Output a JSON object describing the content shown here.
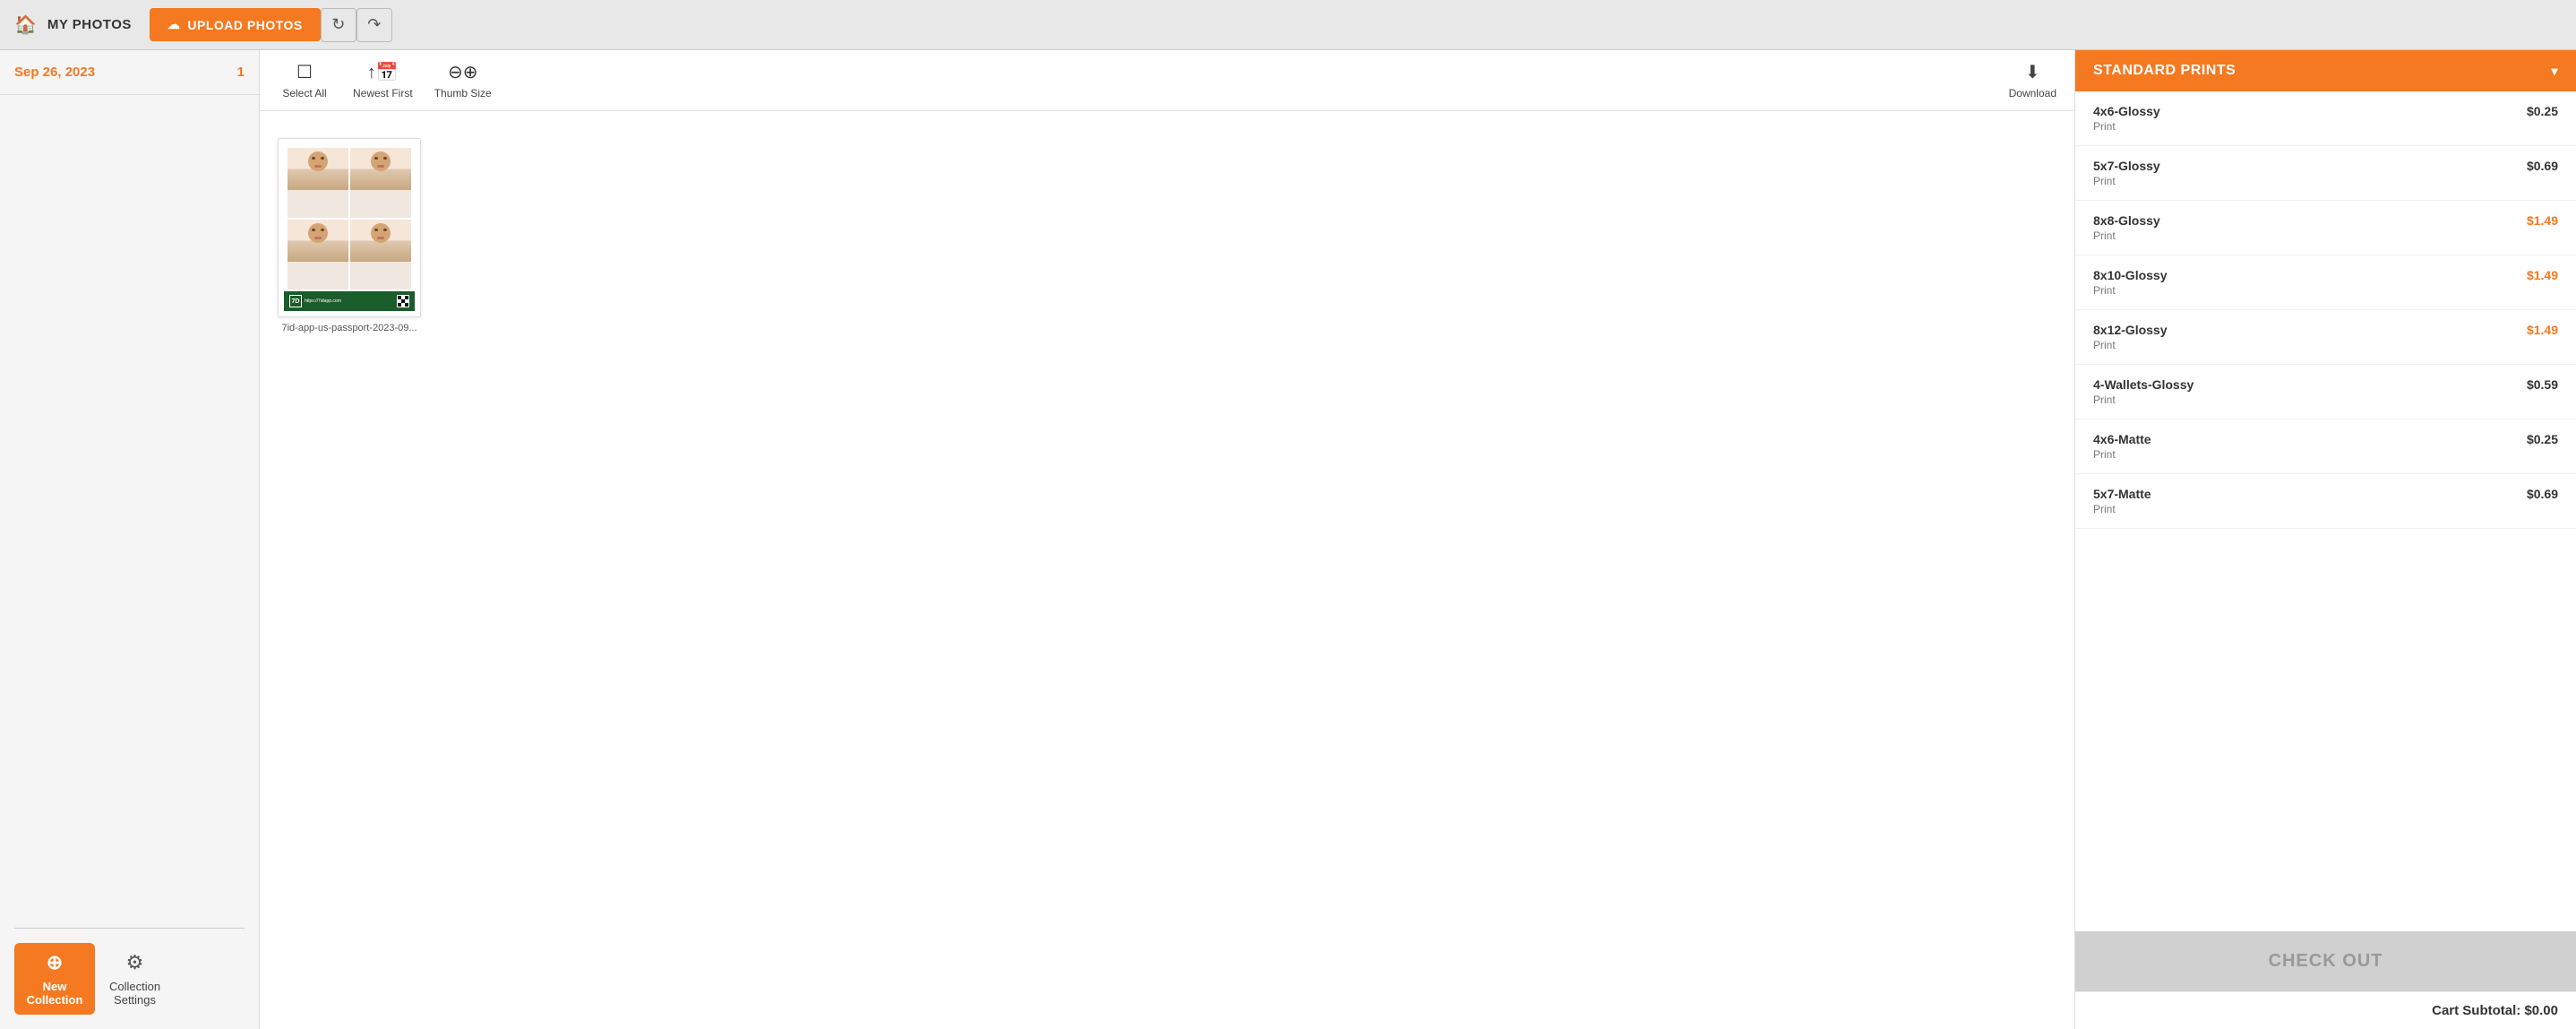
{
  "header": {
    "brand_label": "MY PHOTOS",
    "upload_btn_label": "UPLOAD PHOTOS",
    "refresh_icon": "↻",
    "share_icon": "↷"
  },
  "sidebar": {
    "date": "Sep 26, 2023",
    "count": "1",
    "new_collection_label": "New\nCollection",
    "collection_settings_label": "Collection\nSettings"
  },
  "toolbar": {
    "select_all_label": "Select All",
    "newest_first_label": "Newest First",
    "thumb_size_label": "Thumb Size",
    "download_label": "Download"
  },
  "photos": [
    {
      "filename": "7id-app-us-passport-2023-09..."
    }
  ],
  "right_panel": {
    "header_label": "STANDARD PRINTS",
    "chevron": "▾",
    "prints": [
      {
        "name": "4x6-Glossy",
        "type": "Print",
        "price": "$0.25",
        "highlighted": false
      },
      {
        "name": "5x7-Glossy",
        "type": "Print",
        "price": "$0.69",
        "highlighted": false
      },
      {
        "name": "8x8-Glossy",
        "type": "Print",
        "price": "$1.49",
        "highlighted": true
      },
      {
        "name": "8x10-Glossy",
        "type": "Print",
        "price": "$1.49",
        "highlighted": true
      },
      {
        "name": "8x12-Glossy",
        "type": "Print",
        "price": "$1.49",
        "highlighted": true
      },
      {
        "name": "4-Wallets-Glossy",
        "type": "Print",
        "price": "$0.59",
        "highlighted": false
      },
      {
        "name": "4x6-Matte",
        "type": "Print",
        "price": "$0.25",
        "highlighted": false
      },
      {
        "name": "5x7-Matte",
        "type": "Print",
        "price": "$0.69",
        "highlighted": false
      }
    ],
    "checkout_label": "CHECK OUT",
    "cart_subtotal_label": "Cart Subtotal:",
    "cart_subtotal_value": "$0.00"
  }
}
